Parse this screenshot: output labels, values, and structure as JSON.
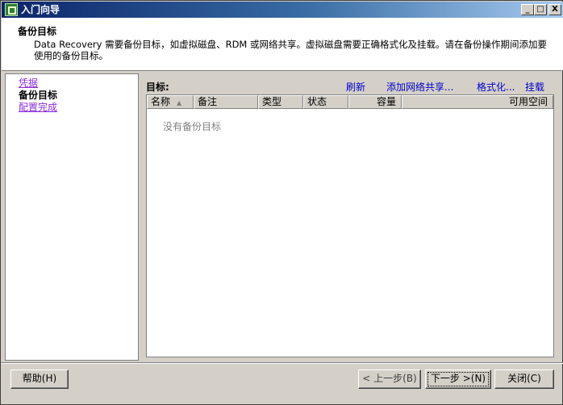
{
  "window": {
    "title": "入门向导",
    "controls": [
      "_",
      "□",
      "X"
    ]
  },
  "header": {
    "title": "备份目标",
    "description": "Data Recovery 需要备份目标，如虚拟磁盘、RDM 或网络共享。虚拟磁盘需要正确格式化及挂载。请在备份操作期间添加要使用的备份目标。"
  },
  "nav": {
    "items": [
      {
        "label": "凭据",
        "state": "link"
      },
      {
        "label": "备份目标",
        "state": "current"
      },
      {
        "label": "配置完成",
        "state": "link"
      }
    ]
  },
  "main": {
    "targets_label": "目标:",
    "actions": {
      "refresh": "刷新",
      "add_network_share": "添加网络共享...",
      "format": "格式化...",
      "mount": "挂载"
    },
    "table": {
      "columns": [
        "名称",
        "备注",
        "类型",
        "状态",
        "容量",
        "可用空间"
      ],
      "sort_icon": "▲",
      "empty_message": "没有备份目标",
      "rows": []
    }
  },
  "buttons": {
    "help": "帮助(H)",
    "back": "< 上一步(B)",
    "next": "下一步 >(N)",
    "close": "关闭(C)"
  },
  "colors": {
    "title_bar_start": "#0a246a",
    "title_bar_end": "#a6caf0",
    "window_bg": "#d4d0c8",
    "link_visited": "#8a2be2",
    "action_link": "#0000cc"
  }
}
